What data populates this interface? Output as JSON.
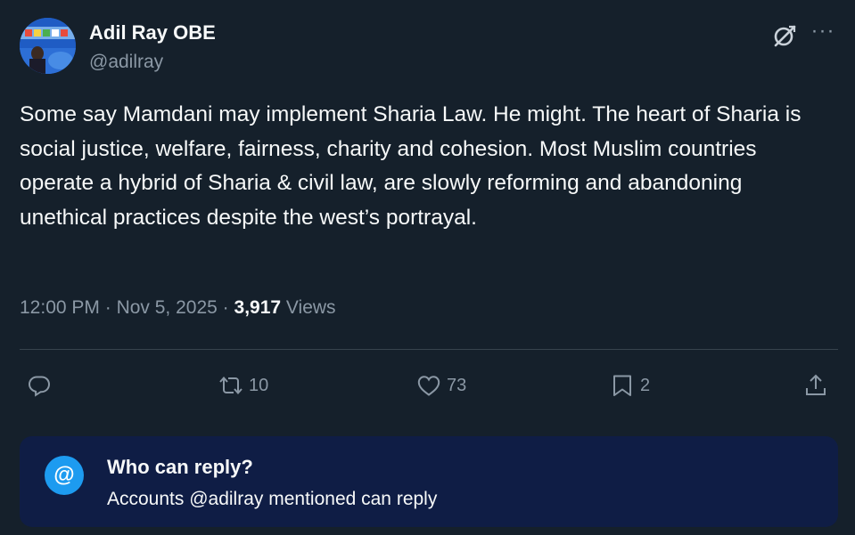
{
  "author": {
    "display_name": "Adil Ray OBE",
    "handle": "@adilray"
  },
  "header_icons": [
    "grok-icon",
    "more-icon"
  ],
  "more_label": "···",
  "tweet": {
    "text": "Some say Mamdani may implement Sharia Law. He might. The heart of Sharia is social justice, welfare, fairness, charity and cohesion. Most Muslim countries operate a hybrid of Sharia & civil law, are slowly reforming and abandoning unethical practices despite the west’s portrayal."
  },
  "meta": {
    "time": "12:00 PM",
    "separator": "·",
    "date": "Nov 5, 2025",
    "views_count": "3,917",
    "views_label": "Views"
  },
  "actions": {
    "reply": {
      "icon": "reply-icon",
      "count": ""
    },
    "repost": {
      "icon": "repost-icon",
      "count": "10"
    },
    "like": {
      "icon": "heart-icon",
      "count": "73"
    },
    "bookmark": {
      "icon": "bookmark-icon",
      "count": "2"
    },
    "share": {
      "icon": "share-icon",
      "count": ""
    }
  },
  "reply_restriction": {
    "badge": "@",
    "title": "Who can reply?",
    "subtitle": "Accounts @adilray mentioned can reply"
  },
  "colors": {
    "background": "#15202b",
    "text_primary": "#f7f9f9",
    "text_secondary": "#8b98a5",
    "accent": "#1d9bf0",
    "reply_box": "#0f1d45"
  }
}
